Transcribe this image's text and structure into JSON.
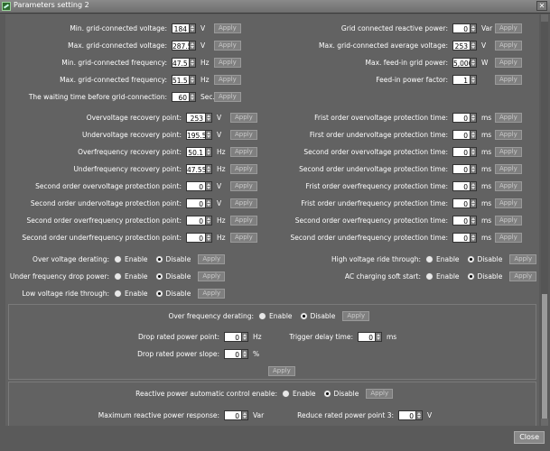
{
  "window": {
    "title": "Parameters setting 2",
    "close_label": "Close"
  },
  "apply_label": "Apply",
  "grid_left": [
    {
      "label": "Min. grid-connected voltage:",
      "value": "184",
      "unit": "V"
    },
    {
      "label": "Max. grid-connected voltage:",
      "value": "287.5",
      "unit": "V"
    },
    {
      "label": "Min. grid-connected frequency:",
      "value": "47.5",
      "unit": "Hz"
    },
    {
      "label": "Max. grid-connected frequency:",
      "value": "51.5",
      "unit": "Hz"
    },
    {
      "label": "The waiting time before grid-connection:",
      "value": "60",
      "unit": "Sec."
    }
  ],
  "grid_right": [
    {
      "label": "Grid connected reactive power:",
      "value": "0",
      "unit": "Var"
    },
    {
      "label": "Max. grid-connected average voltage:",
      "value": "253",
      "unit": "V"
    },
    {
      "label": "Max. feed-in grid power:",
      "value": "5,000",
      "unit": "W"
    },
    {
      "label": "Feed-in power factor:",
      "value": "1",
      "unit": ""
    }
  ],
  "protect_left": [
    {
      "label": "Overvoltage recovery point:",
      "value": "253",
      "unit": "V"
    },
    {
      "label": "Undervoltage recovery point:",
      "value": "195.5",
      "unit": "V"
    },
    {
      "label": "Overfrequency recovery point:",
      "value": "50.1",
      "unit": "Hz"
    },
    {
      "label": "Underfrequency recovery point:",
      "value": "47.55",
      "unit": "Hz"
    },
    {
      "label": "Second order overvoltage protection point:",
      "value": "0",
      "unit": "V"
    },
    {
      "label": "Second order undervoltage protection point:",
      "value": "0",
      "unit": "V"
    },
    {
      "label": "Second order overfrequency protection point:",
      "value": "0",
      "unit": "Hz"
    },
    {
      "label": "Second order underfrequency protection point:",
      "value": "0",
      "unit": "Hz"
    }
  ],
  "protect_right": [
    {
      "label": "Frist order overvoltage protection time:",
      "value": "0",
      "unit": "ms"
    },
    {
      "label": "First order undervoltage protection time:",
      "value": "0",
      "unit": "ms"
    },
    {
      "label": "Second order overvoltage protection time:",
      "value": "0",
      "unit": "ms"
    },
    {
      "label": "Second order undervoltage protection time:",
      "value": "0",
      "unit": "ms"
    },
    {
      "label": "Frist order overfrequency protection time:",
      "value": "0",
      "unit": "ms"
    },
    {
      "label": "Frist order underfrequency protection time:",
      "value": "0",
      "unit": "ms"
    },
    {
      "label": "Second order overfrequency protection time:",
      "value": "0",
      "unit": "ms"
    },
    {
      "label": "Second order underfrequency protection time:",
      "value": "0",
      "unit": "ms"
    }
  ],
  "radio_text": {
    "enable": "Enable",
    "disable": "Disable"
  },
  "toggles_left": [
    {
      "label": "Over voltage derating:",
      "selected": "Disable"
    },
    {
      "label": "Under frequency drop power:",
      "selected": "Disable"
    },
    {
      "label": "Low voltage ride through:",
      "selected": "Disable"
    }
  ],
  "toggles_right": [
    {
      "label": "High voltage ride through:",
      "selected": "Disable"
    },
    {
      "label": "AC charging soft start:",
      "selected": "Disable"
    }
  ],
  "overfreq": {
    "label": "Over frequency derating:",
    "selected": "Disable",
    "drop_point_label": "Drop rated power point:",
    "drop_point_value": "0",
    "drop_point_unit": "Hz",
    "trigger_label": "Trigger delay time:",
    "trigger_value": "0",
    "trigger_unit": "ms",
    "slope_label": "Drop rated power slope:",
    "slope_value": "0",
    "slope_unit": "%"
  },
  "reactive": {
    "label": "Reactive power automatic control enable:",
    "selected": "Disable",
    "max_resp_label": "Maximum reactive power response:",
    "max_resp_value": "0",
    "max_resp_unit": "Var",
    "reduce_label": "Reduce rated power point 3:",
    "reduce_value": "0",
    "reduce_unit": "V"
  },
  "colors": {
    "background": "#626262",
    "field": "#ffffff",
    "text": "#ffffff"
  }
}
